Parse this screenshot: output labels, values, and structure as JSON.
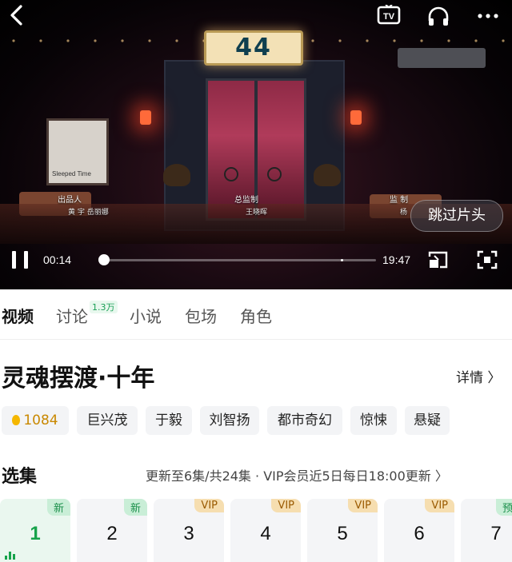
{
  "player": {
    "sign_text": "44",
    "poster_text": "Sleeped Time",
    "credits": {
      "producer_role": "出品人",
      "producer_names": "黄 宇  岳丽娜",
      "chief_role": "总监制",
      "chief_name": "王晓晖",
      "right_role": "监 制",
      "right_name": "杨"
    },
    "skip_label": "跳过片头",
    "current_time": "00:14",
    "total_time": "19:47",
    "progress": 0.012,
    "icons": [
      "back-icon",
      "tv-cast-icon",
      "headphones-icon",
      "more-icon",
      "pause-icon",
      "pip-icon",
      "fullscreen-icon"
    ]
  },
  "tabs": [
    {
      "label": "视频",
      "active": true
    },
    {
      "label": "讨论",
      "badge": "1.3万"
    },
    {
      "label": "小说"
    },
    {
      "label": "包场"
    },
    {
      "label": "角色"
    }
  ],
  "show": {
    "title": "灵魂摆渡·十年",
    "detail_label": "详情 〉",
    "heat": "1084",
    "tags": [
      "巨兴茂",
      "于毅",
      "刘智扬",
      "都市奇幻",
      "惊悚",
      "悬疑"
    ]
  },
  "episodes": {
    "heading": "选集",
    "update_info": "更新至6集/共24集 · VIP会员近5日每日18:00更新 〉",
    "items": [
      {
        "num": "1",
        "badge": "新",
        "type": "new"
      },
      {
        "num": "2",
        "badge": "新",
        "type": "new"
      },
      {
        "num": "3",
        "badge": "VIP",
        "type": "vip"
      },
      {
        "num": "4",
        "badge": "VIP",
        "type": "vip"
      },
      {
        "num": "5",
        "badge": "VIP",
        "type": "vip"
      },
      {
        "num": "6",
        "badge": "VIP",
        "type": "vip"
      },
      {
        "num": "7",
        "badge": "预",
        "type": "new"
      }
    ]
  }
}
